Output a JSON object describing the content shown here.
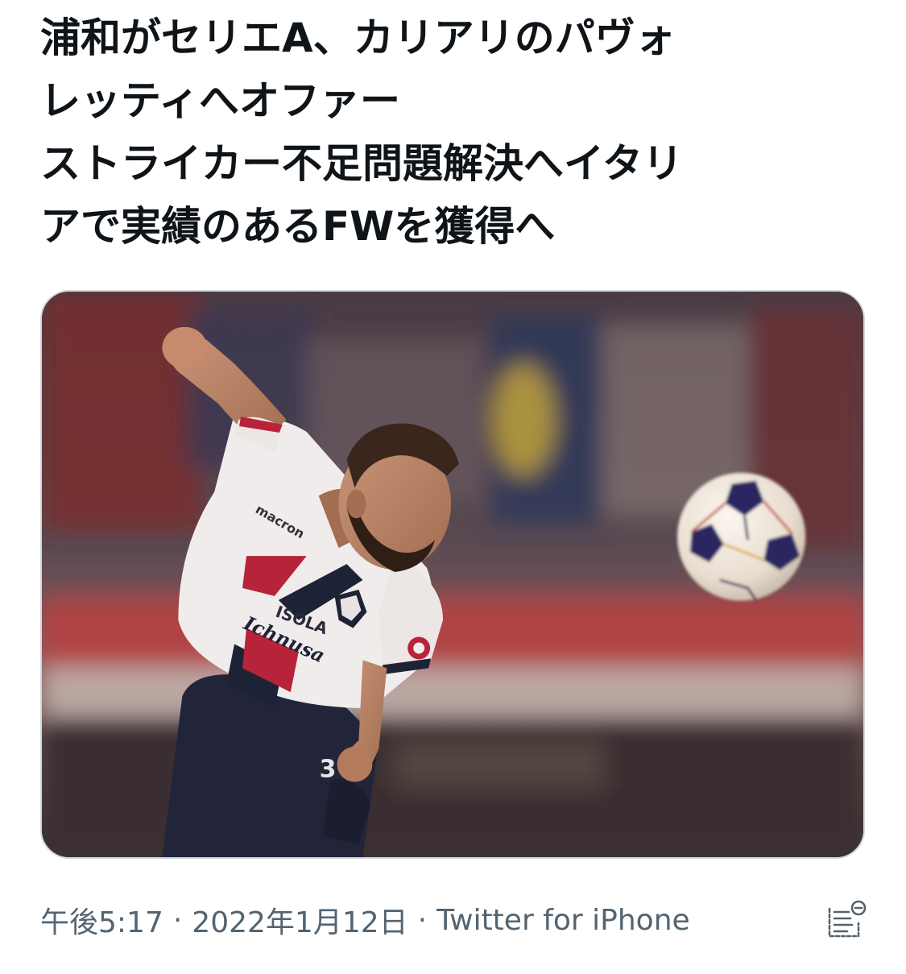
{
  "tweet": {
    "lines": [
      "浦和がセリエA、カリアリのパヴォ",
      "レッティへオファー",
      "ストライカー不足問題解決へイタリ",
      "アで実績のあるFWを獲得へ"
    ]
  },
  "media": {
    "jersey_sponsor": "ISOLA",
    "jersey_brand": "Ichnusa",
    "kit_maker": "macron",
    "shorts_number": "3"
  },
  "meta": {
    "time": "午後5:17",
    "separator": "·",
    "date": "2022年1月12日",
    "source": "Twitter for iPhone"
  },
  "icons": {
    "analytics": "view-activity-icon"
  },
  "colors": {
    "text_primary": "#0f1419",
    "text_secondary": "#536471",
    "border": "#cfd9de"
  }
}
